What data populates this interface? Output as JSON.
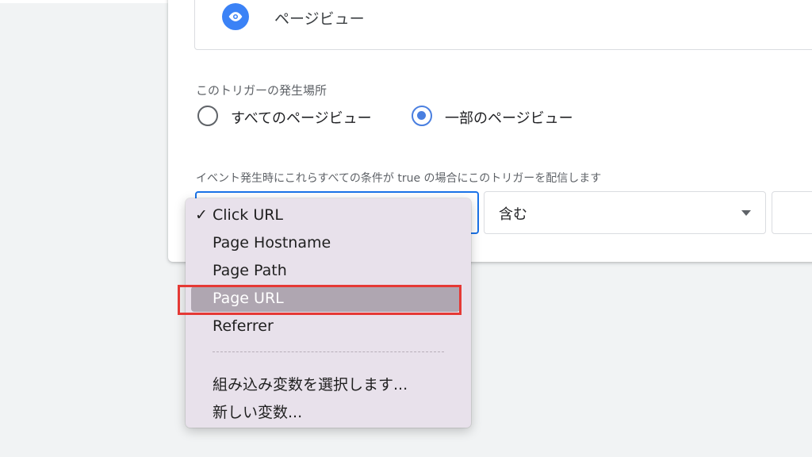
{
  "trigger_type": {
    "label": "ページビュー",
    "icon": "eye-icon",
    "icon_color": "#3b82f6"
  },
  "fire_on": {
    "label": "このトリガーの発生場所",
    "options": [
      {
        "label": "すべてのページビュー",
        "selected": false
      },
      {
        "label": "一部のページビュー",
        "selected": true
      }
    ]
  },
  "condition": {
    "label": "イベント発生時にこれらすべての条件が true の場合にこのトリガーを配信します",
    "variable": "Click URL",
    "operator": "含む",
    "value": ""
  },
  "dropdown": {
    "items": [
      {
        "label": "Click URL",
        "checked": true
      },
      {
        "label": "Page Hostname"
      },
      {
        "label": "Page Path"
      },
      {
        "label": "Page URL",
        "highlighted": true
      },
      {
        "label": "Referrer"
      }
    ],
    "actions": [
      {
        "label": "組み込み変数を選択します..."
      },
      {
        "label": "新しい変数..."
      }
    ],
    "check_glyph": "✓"
  },
  "colors": {
    "accent": "#1a73e8",
    "radio_selected": "#4a7fe0",
    "annotation": "#e53935"
  }
}
